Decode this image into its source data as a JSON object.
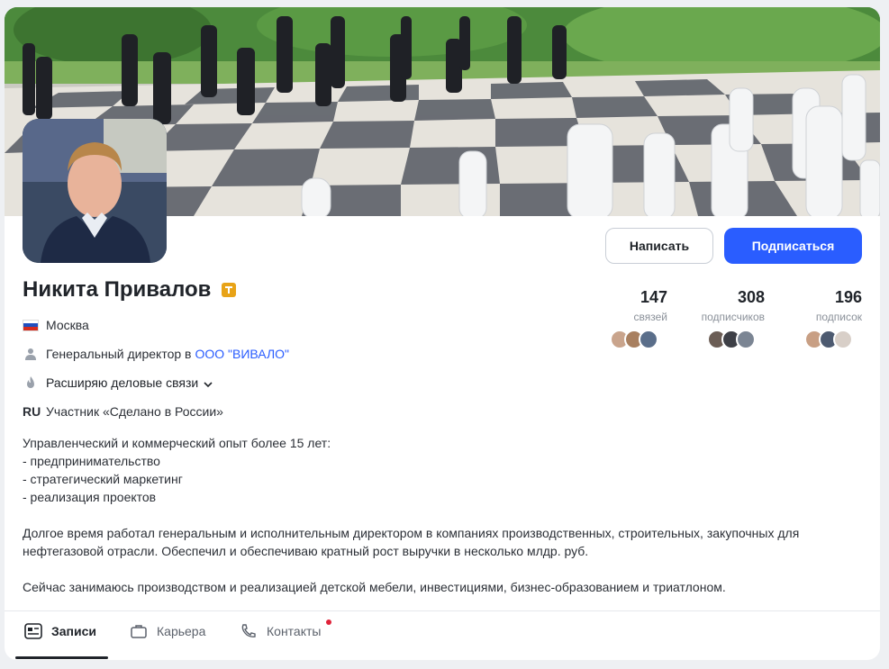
{
  "profile": {
    "name": "Никита Привалов",
    "city": "Москва",
    "position_prefix": "Генеральный директор в",
    "company": "ООО \"ВИВАЛО\"",
    "goal": "Расширяю деловые связи",
    "ru_mark": "RU",
    "ru_text": "Участник «Сделано в России»"
  },
  "actions": {
    "write_label": "Написать",
    "subscribe_label": "Подписаться"
  },
  "stats": [
    {
      "value": "147",
      "label": "связей"
    },
    {
      "value": "308",
      "label": "подписчиков"
    },
    {
      "value": "196",
      "label": "подписок"
    }
  ],
  "about": {
    "p1_line1": "Управленческий и коммерческий опыт более 15 лет:",
    "p1_line2": "- предпринимательство",
    "p1_line3": "- стратегический маркетинг",
    "p1_line4": "- реализация проектов",
    "p2": "Долгое время работал генеральным и исполнительным директором в компаниях производственных, строительных, закупочных для нефтегазовой отрасли. Обеспечил и обеспечиваю кратный рост выручки в несколько млдр. руб.",
    "p3": "Сейчас занимаюсь производством и реализацией детской мебели, инвестициями, бизнес-образованием и триатлоном."
  },
  "tabs": [
    {
      "label": "Записи",
      "icon": "feed-icon",
      "active": true
    },
    {
      "label": "Карьера",
      "icon": "briefcase-icon",
      "active": false
    },
    {
      "label": "Контакты",
      "icon": "phone-icon",
      "active": false
    }
  ],
  "colors": {
    "accent": "#2a5dff",
    "badge": "#e8a317",
    "notification_dot": "#e0233a"
  }
}
